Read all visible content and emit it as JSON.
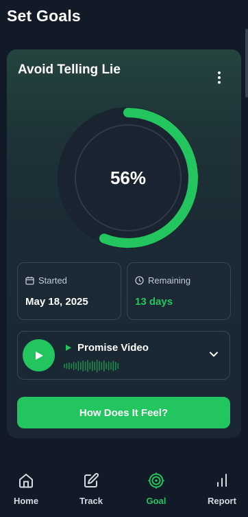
{
  "header": {
    "title": "Set Goals"
  },
  "goal": {
    "title": "Avoid Telling Lie",
    "progress_percent": 56,
    "progress_label": "56%"
  },
  "stats": {
    "started": {
      "label": "Started",
      "value": "May 18, 2025",
      "icon": "calendar-icon"
    },
    "remaining": {
      "label": "Remaining",
      "value": "13 days",
      "icon": "clock-icon"
    }
  },
  "video": {
    "label": "Promise Video",
    "play_icon": "play-icon",
    "expand_icon": "chevron-down-icon"
  },
  "cta": {
    "label": "How Does It Feel?"
  },
  "nav": {
    "items": [
      {
        "label": "Home",
        "icon": "home-icon",
        "active": false
      },
      {
        "label": "Track",
        "icon": "edit-icon",
        "active": false
      },
      {
        "label": "Goal",
        "icon": "target-icon",
        "active": true
      },
      {
        "label": "Report",
        "icon": "bar-chart-icon",
        "active": false
      }
    ]
  },
  "colors": {
    "accent": "#22c55e",
    "background": "#111a26",
    "card": "#1a2633",
    "ring_track": "#1a2330",
    "border": "#3a4654"
  }
}
